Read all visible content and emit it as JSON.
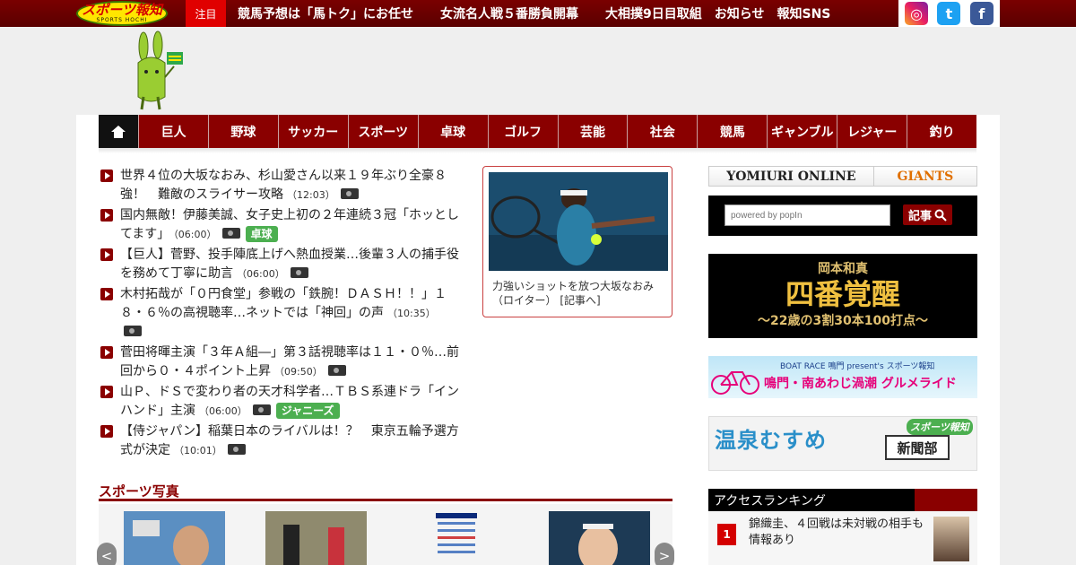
{
  "header": {
    "logo_text": "スポーツ報知",
    "logo_sub": "SPORTS HOCHI",
    "chumoku": "注目",
    "links": [
      "競馬予想は「馬トク」にお任せ",
      "女流名人戦５番勝負開幕",
      "大相撲9日目取組",
      "お知らせ",
      "報知SNS"
    ]
  },
  "social": [
    "instagram-icon",
    "twitter-icon",
    "facebook-icon"
  ],
  "nav": {
    "home_icon": "home-icon",
    "items": [
      "巨人",
      "野球",
      "サッカー",
      "スポーツ",
      "卓球",
      "ゴルフ",
      "芸能",
      "社会",
      "競馬",
      "ギャンブル",
      "レジャー",
      "釣り"
    ]
  },
  "news": [
    {
      "title": "世界４位の大坂なおみ、杉山愛さん以来１９年ぶり全豪８強！　難敵のスライサー攻略",
      "time": "（12:03）",
      "tag": ""
    },
    {
      "title": "国内無敵！伊藤美誠、女子史上初の２年連続３冠「ホッとしてます」",
      "time": "（06:00）",
      "tag": "卓球"
    },
    {
      "title": "【巨人】菅野、投手陣底上げへ熱血授業…後輩３人の捕手役を務めて丁寧に助言",
      "time": "（06:00）",
      "tag": ""
    },
    {
      "title": "木村拓哉が「０円食堂」参戦の「鉄腕！ＤＡＳＨ！！」１８・６％の高視聴率…ネットでは「神回」の声",
      "time": "（10:35）",
      "tag": ""
    },
    {
      "title": "菅田将暉主演「３年Ａ組―」第３話視聴率は１１・０％…前回から０・４ポイント上昇",
      "time": "（09:50）",
      "tag": ""
    },
    {
      "title": "山Ｐ、ドＳで変わり者の天才科学者…ＴＢＳ系連ドラ「インハンド」主演",
      "time": "（06:00）",
      "tag": "ジャニーズ"
    },
    {
      "title": "【侍ジャパン】稲葉日本のライバルは！？　東京五輪予選方式が決定",
      "time": "（10:01）",
      "tag": ""
    }
  ],
  "feature": {
    "caption": "力強いショットを放つ大坂なおみ（ロイター）",
    "link": "[記事へ]"
  },
  "right": {
    "yomiuri": "YOMIURI ONLINE",
    "giants": "GIANTS",
    "search_placeholder": "powered by popIn",
    "search_button": "記事",
    "banner1_top": "岡本和真",
    "banner1_main": "四番覚醒",
    "banner1_sub": "～22歳の3割30本100打点～",
    "banner2_top": "BOAT RACE 鳴門 present's スポーツ報知",
    "banner2_main": "鳴門・南あわじ渦潮 グルメライド",
    "banner3_main": "温泉むすめ",
    "banner3_box": "新聞部",
    "banner3_badge": "スポーツ報知"
  },
  "photos": {
    "title": "スポーツ写真",
    "prev": "<",
    "next": ">"
  },
  "ranking": {
    "title": "アクセスランキング",
    "items": [
      {
        "rank": "1",
        "title": "錦織圭、４回戦は未対戦の相手も情報あり"
      }
    ]
  }
}
